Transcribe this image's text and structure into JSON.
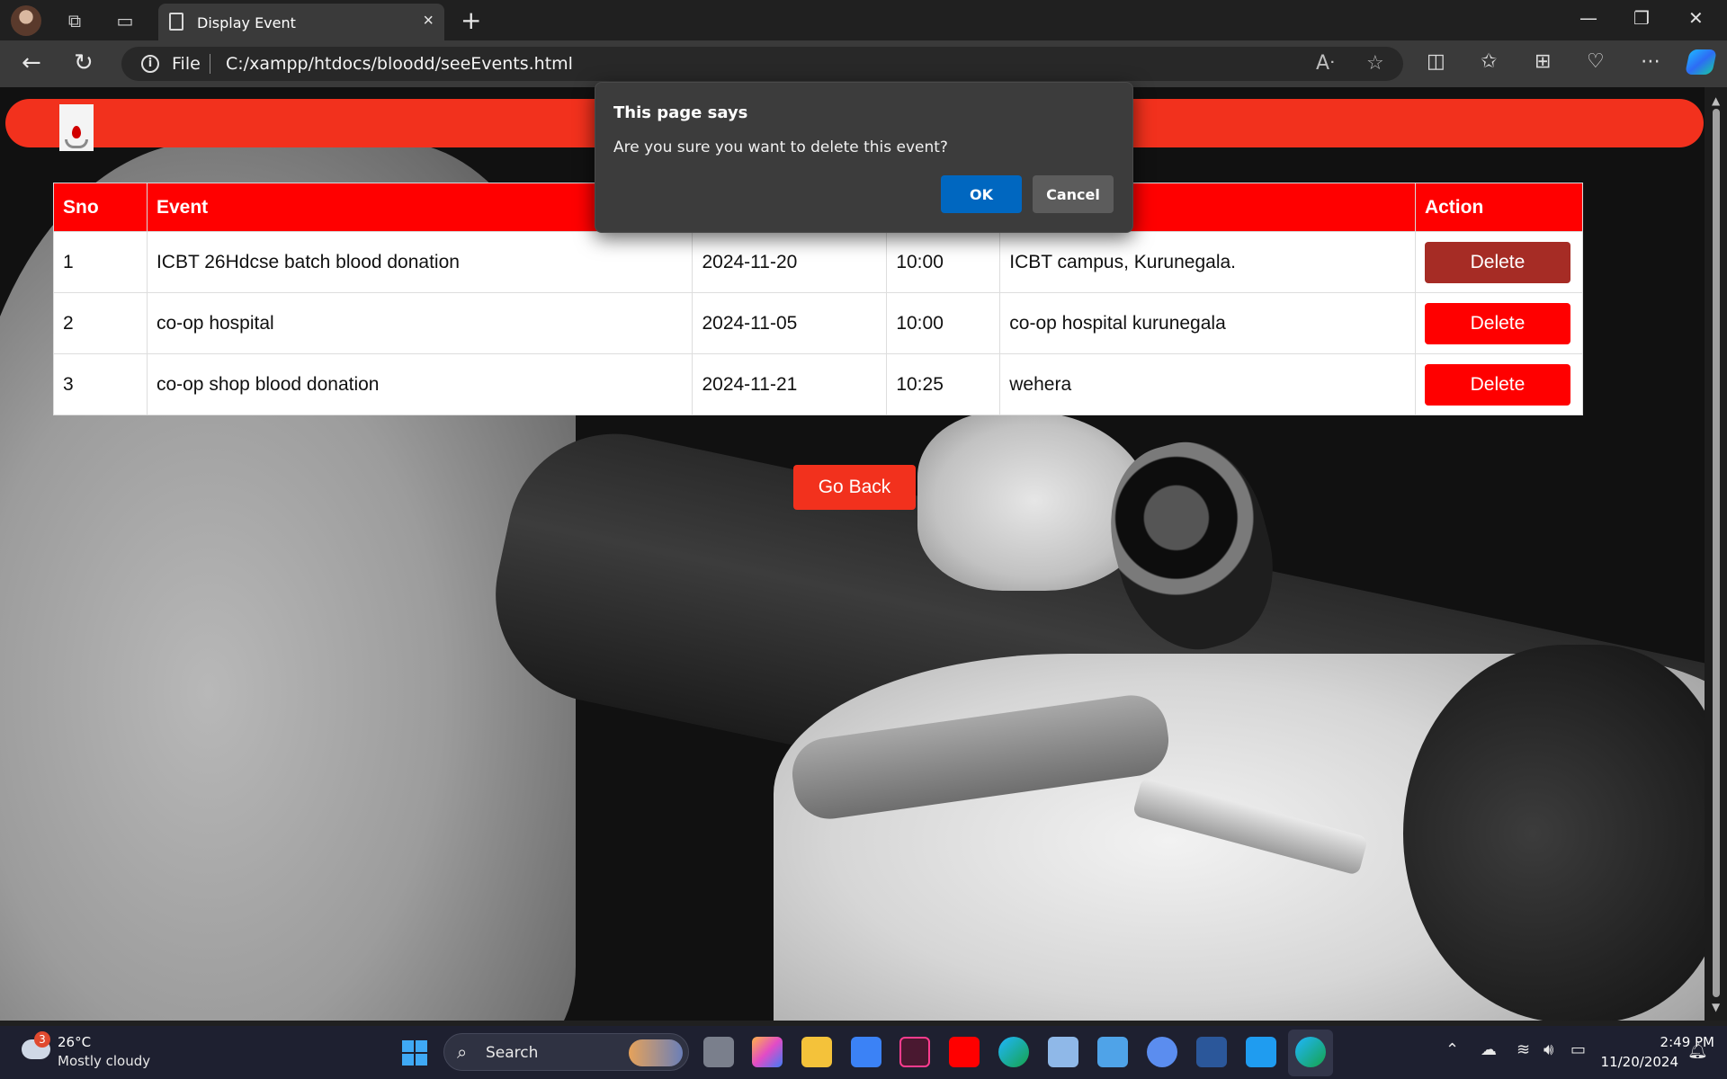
{
  "browser": {
    "tab_title": "Display Event",
    "new_tab_glyph": "+",
    "close_tab_glyph": "×",
    "address_file_label": "File",
    "address_url": "C:/xampp/htdocs/bloodd/seeEvents.html",
    "window_controls": {
      "minimize": "—",
      "restore": "❐",
      "close": "✕"
    },
    "icons": [
      "profile-avatar",
      "workspaces-icon",
      "tab-actions-icon",
      "page-icon",
      "back-arrow-icon",
      "refresh-icon",
      "info-icon",
      "read-aloud-icon",
      "favorite-star-icon",
      "split-screen-icon",
      "favorites-icon",
      "collections-icon",
      "browser-essentials-icon",
      "more-menu-icon",
      "copilot-icon"
    ]
  },
  "page": {
    "table": {
      "headers": [
        "Sno",
        "Event",
        "",
        "",
        "",
        "Action"
      ],
      "rows": [
        {
          "sno": "1",
          "event": "ICBT 26Hdcse batch blood donation",
          "date": "2024-11-20",
          "time": "10:00",
          "location": "ICBT campus, Kurunegala.",
          "action": "Delete"
        },
        {
          "sno": "2",
          "event": "co-op hospital",
          "date": "2024-11-05",
          "time": "10:00",
          "location": "co-op hospital kurunegala",
          "action": "Delete"
        },
        {
          "sno": "3",
          "event": "co-op shop blood donation",
          "date": "2024-11-21",
          "time": "10:25",
          "location": "wehera",
          "action": "Delete"
        }
      ]
    },
    "go_back_label": "Go Back",
    "colors": {
      "header_bar": "#f2311d",
      "table_header": "#ff0000",
      "delete_button": "#ff0000",
      "delete_button_hover": "#a62c25"
    }
  },
  "dialog": {
    "title": "This page says",
    "message": "Are you sure you want to delete this event?",
    "ok_label": "OK",
    "cancel_label": "Cancel"
  },
  "taskbar": {
    "weather_badge": "3",
    "weather_temp": "26°C",
    "weather_desc": "Mostly cloudy",
    "search_label": "Search",
    "time": "2:49 PM",
    "date": "11/20/2024",
    "apps": [
      "file-explorer-icon",
      "copilot-app-icon",
      "folder-icon",
      "store-icon",
      "indesign-icon",
      "youtube-icon",
      "edge-icon",
      "photos-icon",
      "paint-icon",
      "app-icon",
      "word-icon",
      "vscode-icon",
      "edge-active-icon"
    ]
  }
}
